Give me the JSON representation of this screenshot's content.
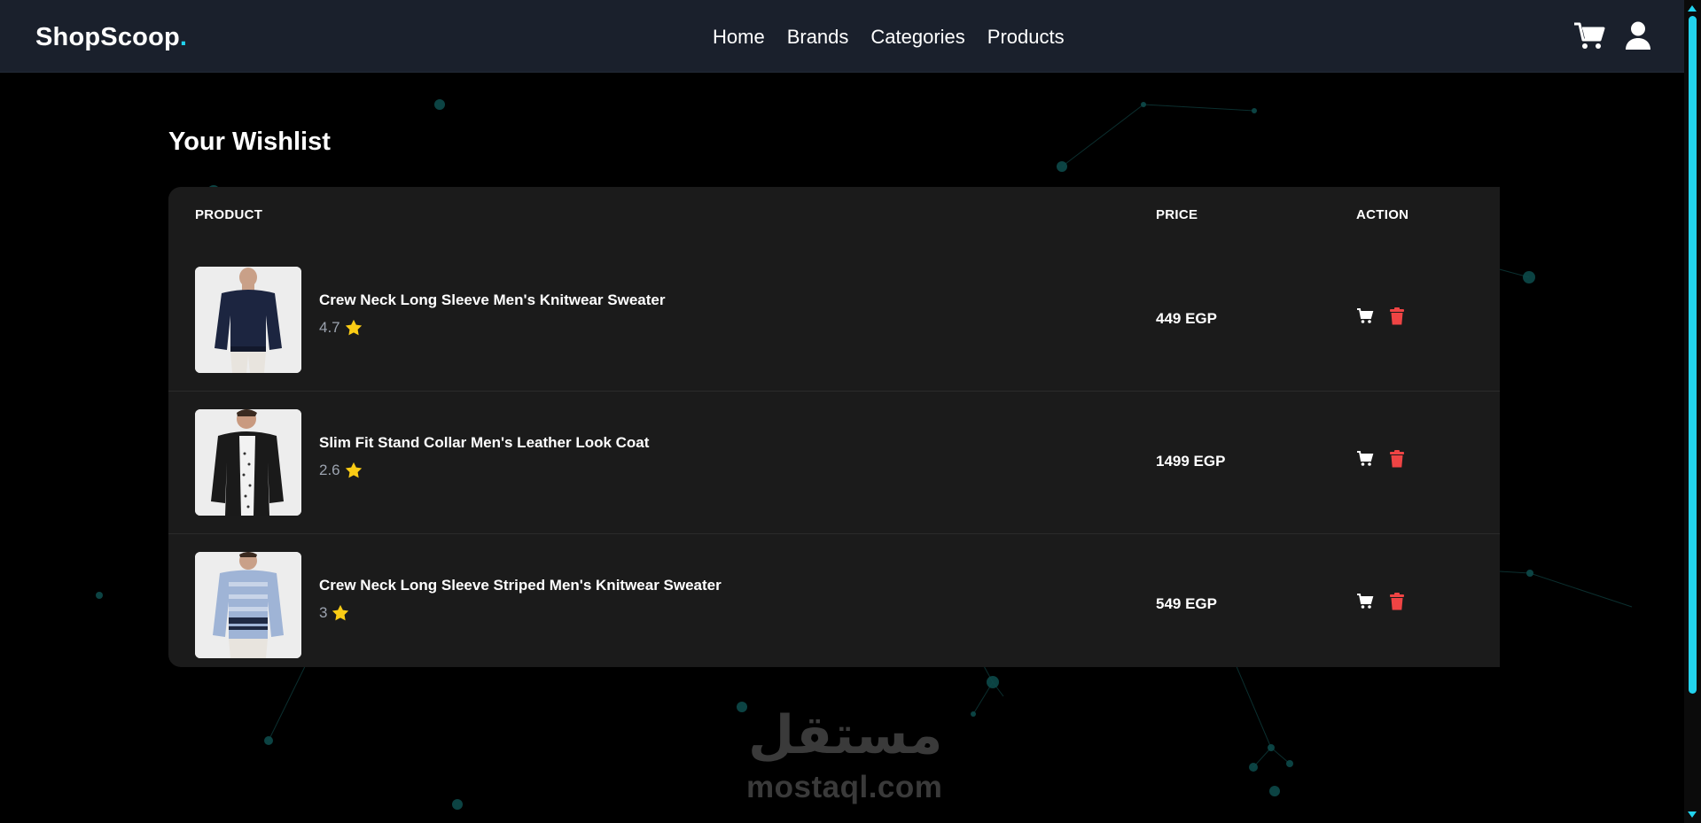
{
  "brand": {
    "name": "ShopScoop",
    "dot": "."
  },
  "nav": {
    "links": [
      "Home",
      "Brands",
      "Categories",
      "Products"
    ]
  },
  "colors": {
    "accent": "#22d3ee",
    "star": "#facc15",
    "delete": "#ef4444",
    "navbar": "#1a202c",
    "table": "#1b1b1b"
  },
  "icons": {
    "cart_nav": "cart-icon",
    "user_nav": "user-icon",
    "add_to_cart": "cart-icon",
    "delete": "trash-icon",
    "rating": "star-icon"
  },
  "wishlist": {
    "title": "Your Wishlist",
    "headers": {
      "product": "PRODUCT",
      "price": "PRICE",
      "action": "ACTION"
    },
    "items": [
      {
        "name": "Crew Neck Long Sleeve Men's Knitwear Sweater",
        "rating": "4.7",
        "price": "449 EGP"
      },
      {
        "name": "Slim Fit Stand Collar Men's Leather Look Coat",
        "rating": "2.6",
        "price": "1499 EGP"
      },
      {
        "name": "Crew Neck Long Sleeve Striped Men's Knitwear Sweater",
        "rating": "3",
        "price": "549 EGP"
      }
    ]
  },
  "watermark": {
    "arabic": "مستقل",
    "domain": "mostaql.com"
  }
}
